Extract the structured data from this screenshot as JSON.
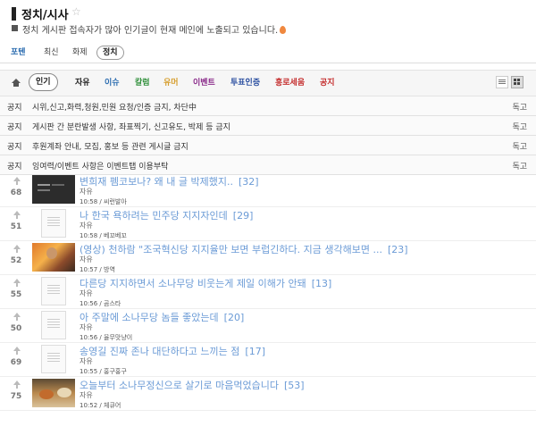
{
  "header": {
    "title": "정치/시사",
    "star_icon": "star-outline-icon",
    "subtitle": "정치 게시판 접속자가 많아 인기글이 현재 메인에 노출되고 있습니다."
  },
  "tabs": [
    {
      "label": "포텐"
    },
    {
      "label": "최신"
    },
    {
      "label": "화제"
    },
    {
      "label": "정치"
    }
  ],
  "categories": [
    {
      "label": "인기",
      "color": "#222222"
    },
    {
      "label": "자유",
      "color": "#222222"
    },
    {
      "label": "이슈",
      "color": "#2b6cb0"
    },
    {
      "label": "칼럼",
      "color": "#2f8f3a"
    },
    {
      "label": "유머",
      "color": "#d69e2e"
    },
    {
      "label": "이벤트",
      "color": "#8a2b8a"
    },
    {
      "label": "투표인증",
      "color": "#2b4fa0"
    },
    {
      "label": "홍로세움",
      "color": "#c53030"
    },
    {
      "label": "공지",
      "color": "#c53030"
    }
  ],
  "notices": [
    {
      "label": "공지",
      "title": "시위,신고,화력,청원,민원 요청/인증 금지, 차단中",
      "author": "독고"
    },
    {
      "label": "공지",
      "title": "게시판 간 분란발생 사항, 좌표찍기, 신고유도, 박제 등 금지",
      "author": "독고"
    },
    {
      "label": "공지",
      "title": "후원계좌 안내, 모집, 홍보 등 관련 게시글 금지",
      "author": "독고"
    },
    {
      "label": "공지",
      "title": "잉여력/이벤트 사항은 이벤트탭 이용부탁",
      "author": "독고"
    }
  ],
  "posts": [
    {
      "votes": "68",
      "title": "변희재 펨코보나? 왜 내 글 박제했지..",
      "comments": "[32]",
      "board": "자유",
      "time": "10:58",
      "author": "씨런발아"
    },
    {
      "votes": "51",
      "title": "나 한국 욕하려는 민주당 지지자인데",
      "comments": "[29]",
      "board": "자유",
      "time": "10:58",
      "author": "베꼬베꼬"
    },
    {
      "votes": "52",
      "title": "(영상) 천하람 \"조국혁신당 지지율만 보면 부럽긴하다. 지금 생각해보면 ...",
      "comments": "[23]",
      "board": "자유",
      "time": "10:57",
      "author": "방역"
    },
    {
      "votes": "55",
      "title": "다른당 지지하면서 소나무당 비웃는게 제일 이해가 안돼",
      "comments": "[13]",
      "board": "자유",
      "time": "10:56",
      "author": "곰스타"
    },
    {
      "votes": "50",
      "title": "아 주말에 소나무당 놈들 좋았는데",
      "comments": "[20]",
      "board": "자유",
      "time": "10:56",
      "author": "율무맛냥이"
    },
    {
      "votes": "69",
      "title": "송영길 진짜 존나 대단하다고 느끼는 점",
      "comments": "[17]",
      "board": "자유",
      "time": "10:55",
      "author": "홍구홍구"
    },
    {
      "votes": "75",
      "title": "오늘부터 소나무정신으로 살기로 마음먹었습니다",
      "comments": "[53]",
      "board": "자유",
      "time": "10:52",
      "author": "체큐어"
    }
  ]
}
